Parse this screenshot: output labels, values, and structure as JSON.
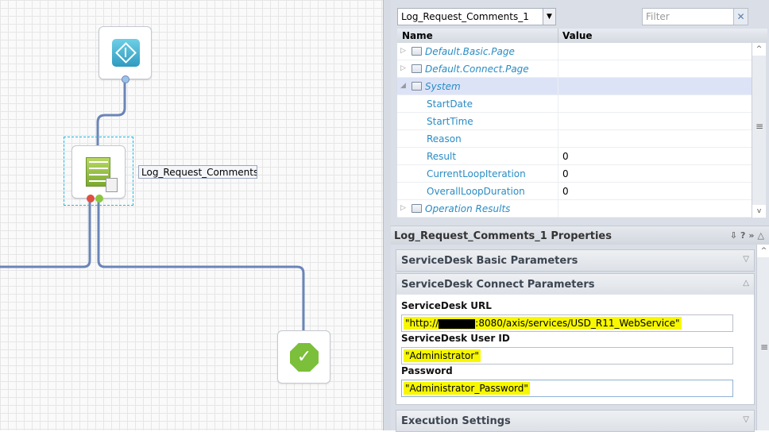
{
  "canvas": {
    "node_label": "Log_Request_Comments_"
  },
  "dataset_panel": {
    "selector_value": "Log_Request_Comments_1",
    "filter_placeholder": "Filter",
    "columns": {
      "name": "Name",
      "value": "Value"
    },
    "rows": [
      {
        "name": "Default.Basic.Page",
        "value": "",
        "type": "folder"
      },
      {
        "name": "Default.Connect.Page",
        "value": "",
        "type": "folder"
      },
      {
        "name": "System",
        "value": "",
        "type": "folder-open"
      },
      {
        "name": "StartDate",
        "value": "",
        "type": "field"
      },
      {
        "name": "StartTime",
        "value": "",
        "type": "field"
      },
      {
        "name": "Reason",
        "value": "",
        "type": "field"
      },
      {
        "name": "Result",
        "value": "0",
        "type": "field"
      },
      {
        "name": "CurrentLoopIteration",
        "value": "0",
        "type": "field"
      },
      {
        "name": "OverallLoopDuration",
        "value": "0",
        "type": "field"
      },
      {
        "name": "Operation Results",
        "value": "",
        "type": "folder"
      }
    ]
  },
  "properties": {
    "title": "Log_Request_Comments_1 Properties",
    "sections": {
      "basic": "ServiceDesk Basic Parameters",
      "connect": "ServiceDesk Connect Parameters",
      "execution": "Execution Settings"
    },
    "fields": {
      "url_label": "ServiceDesk URL",
      "url_prefix": "\"http://",
      "url_suffix": ":8080/axis/services/USD_R11_WebService\"",
      "user_label": "ServiceDesk User ID",
      "user_value": "\"Administrator\"",
      "password_label": "Password",
      "password_value": "\"Administrator_Password\""
    }
  }
}
